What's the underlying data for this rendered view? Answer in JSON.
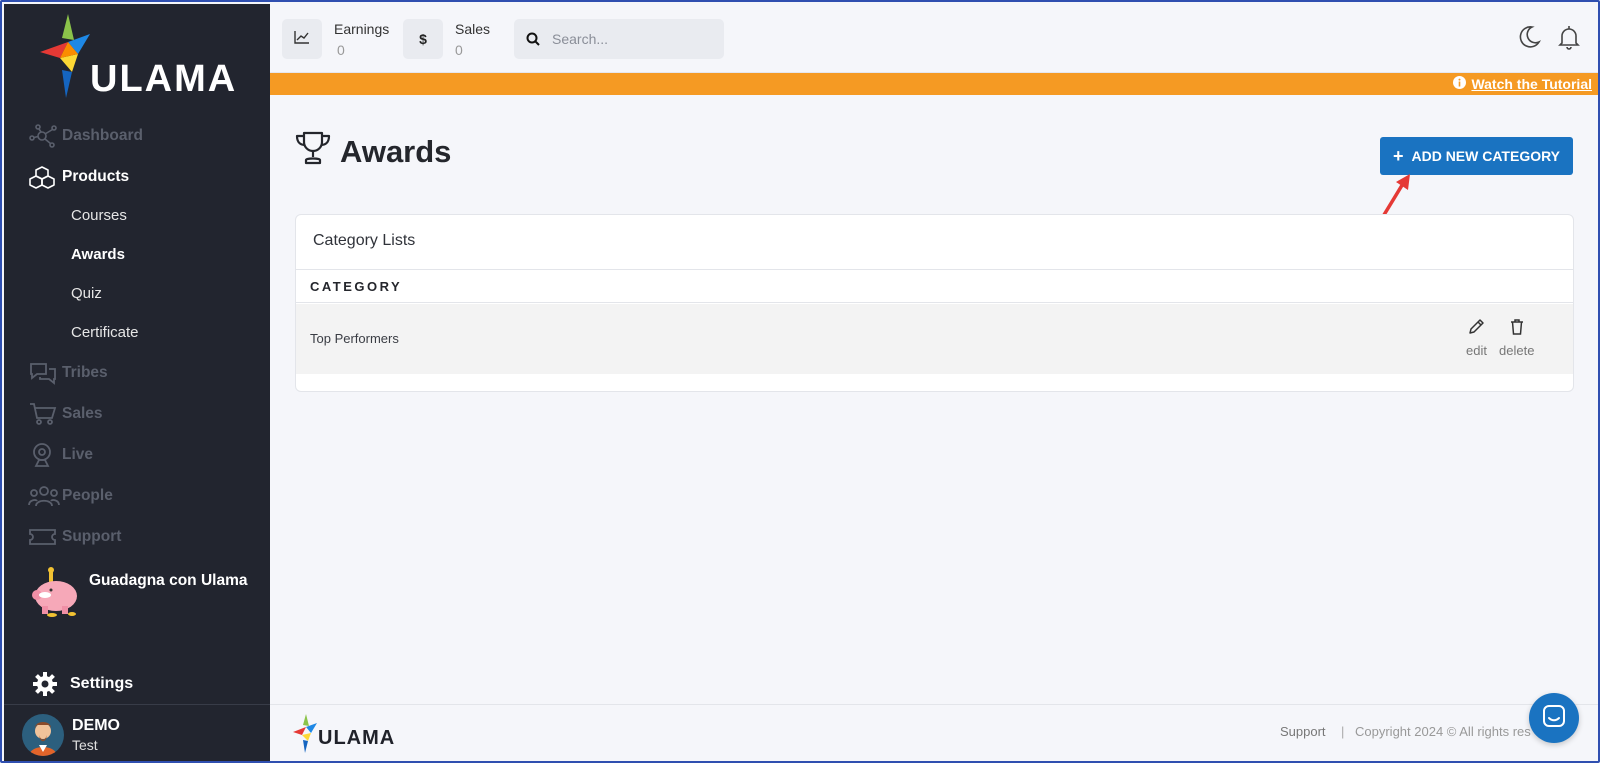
{
  "app": {
    "logo_text": "ULAMA"
  },
  "sidebar": {
    "items": [
      {
        "label": "Dashboard",
        "icon": "network-icon"
      },
      {
        "label": "Products",
        "icon": "cubes-icon"
      },
      {
        "label": "Tribes",
        "icon": "chat-bubbles-icon"
      },
      {
        "label": "Sales",
        "icon": "cart-icon"
      },
      {
        "label": "Live",
        "icon": "webcam-icon"
      },
      {
        "label": "People",
        "icon": "people-icon"
      },
      {
        "label": "Support",
        "icon": "ticket-icon"
      }
    ],
    "sub_items": [
      "Courses",
      "Awards",
      "Quiz",
      "Certificate"
    ],
    "earn_label": "Guadagna con Ulama",
    "settings_label": "Settings",
    "user": {
      "name": "DEMO",
      "sub": "Test"
    }
  },
  "topbar": {
    "earnings_label": "Earnings",
    "earnings_value": "0",
    "sales_label": "Sales",
    "sales_value": "0",
    "search_placeholder": "Search..."
  },
  "banner": {
    "link_text": "Watch the Tutorial",
    "color": "#f59a23"
  },
  "main": {
    "title": "Awards",
    "add_button": "ADD NEW CATEGORY",
    "card_title": "Category Lists",
    "column_header": "CATEGORY",
    "rows": [
      {
        "category": "Top Performers",
        "edit": "edit",
        "delete": "delete"
      }
    ]
  },
  "footer": {
    "logo_text": "ULAMA",
    "support": "Support",
    "separator": "|",
    "copyright": "Copyright 2024 © All rights res"
  },
  "colors": {
    "sidebar_bg": "#22252f",
    "accent": "#1a73c1",
    "banner": "#f59a23"
  }
}
